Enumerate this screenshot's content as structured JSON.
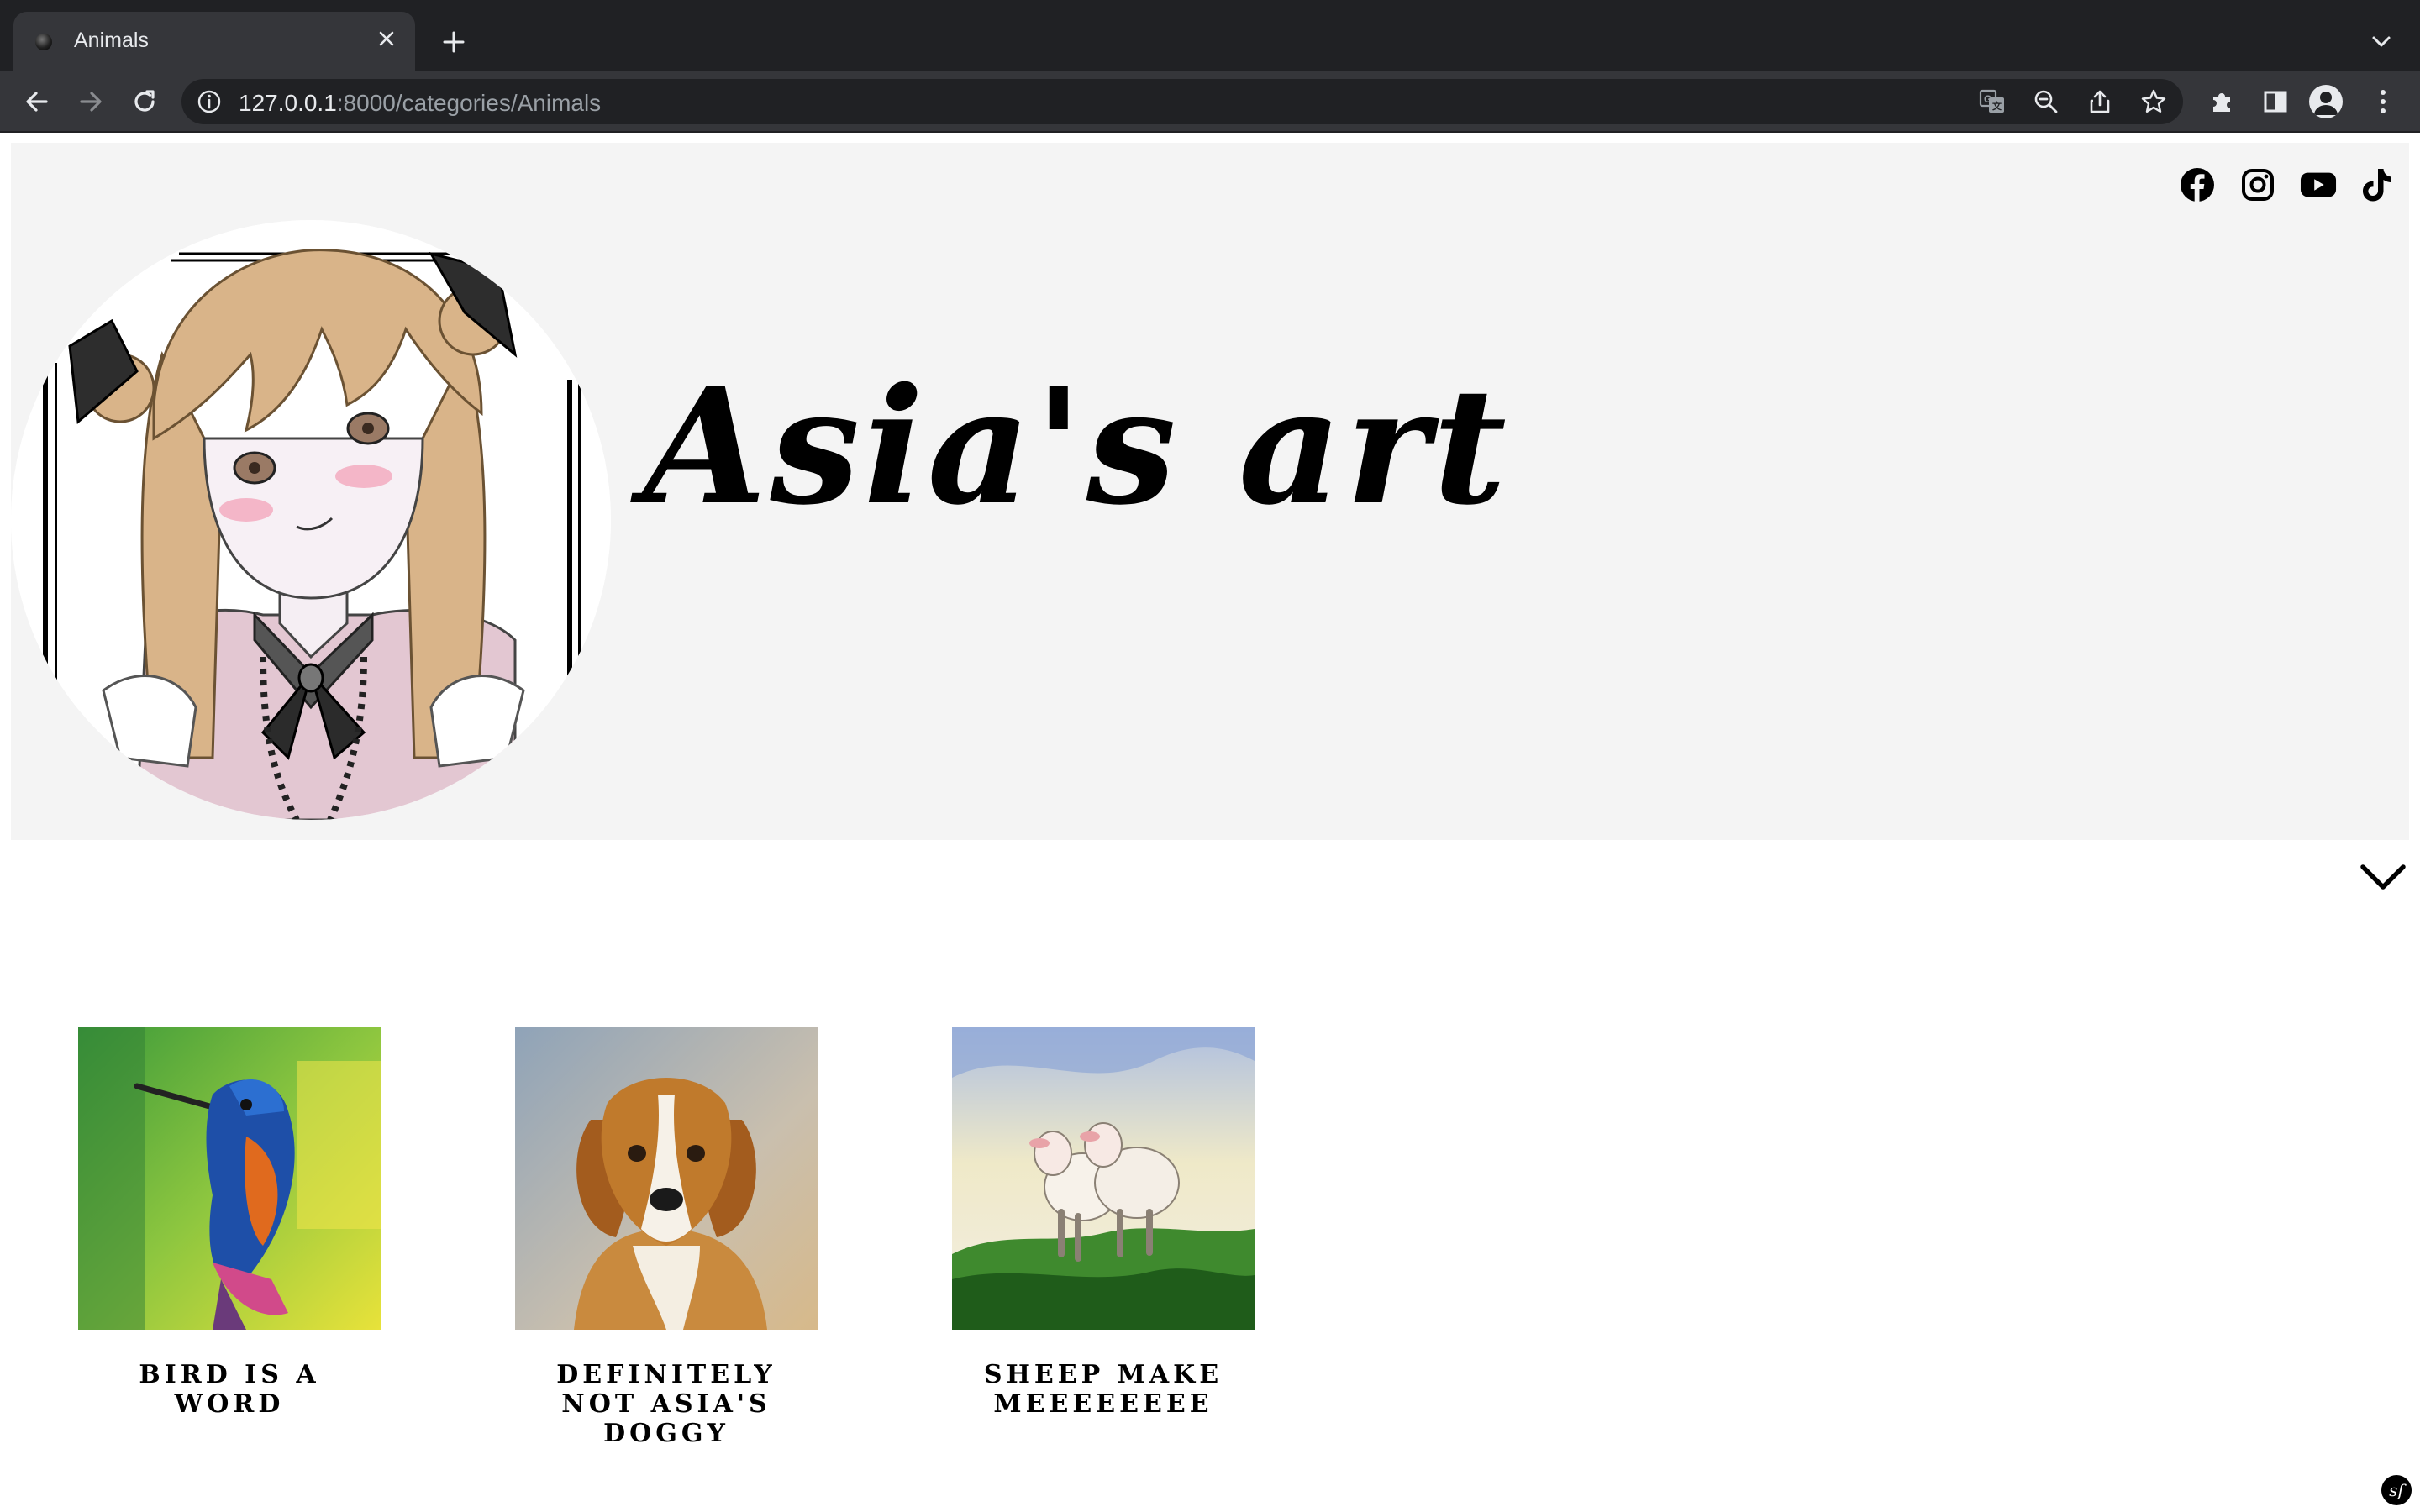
{
  "browser": {
    "tab": {
      "title": "Animals"
    },
    "url": {
      "host": "127.0.0.1",
      "rest": ":8000/categories/Animals"
    },
    "icons": {
      "tab_close": "close-icon",
      "new_tab": "plus-icon",
      "tab_search": "chevron-down-icon",
      "back": "arrow-left-icon",
      "forward": "arrow-right-icon",
      "reload": "reload-icon",
      "site_info": "info-icon",
      "translate": "translate-icon",
      "zoom": "zoom-out-icon",
      "share": "share-icon",
      "bookmark": "star-icon",
      "extensions": "puzzle-icon",
      "side_panel": "side-panel-icon",
      "profile": "profile-icon",
      "menu": "kebab-menu-icon"
    }
  },
  "header": {
    "site_title": "Asia's art",
    "social": [
      {
        "name": "facebook",
        "icon": "facebook-icon"
      },
      {
        "name": "instagram",
        "icon": "instagram-icon"
      },
      {
        "name": "youtube",
        "icon": "youtube-icon"
      },
      {
        "name": "tiktok",
        "icon": "tiktok-icon"
      }
    ],
    "menu_toggle_icon": "chevron-down-icon"
  },
  "gallery": [
    {
      "title": "Bird is a word"
    },
    {
      "title": "Definitely not Asia's doggy"
    },
    {
      "title": "Sheep make meeeeeeee"
    }
  ],
  "footer": {
    "badge": "sf"
  },
  "colors": {
    "chrome_dark": "#202124",
    "chrome_tab": "#35363a",
    "chrome_text": "#e8eaed",
    "hero_bg": "#f4f4f4",
    "text": "#000000"
  }
}
